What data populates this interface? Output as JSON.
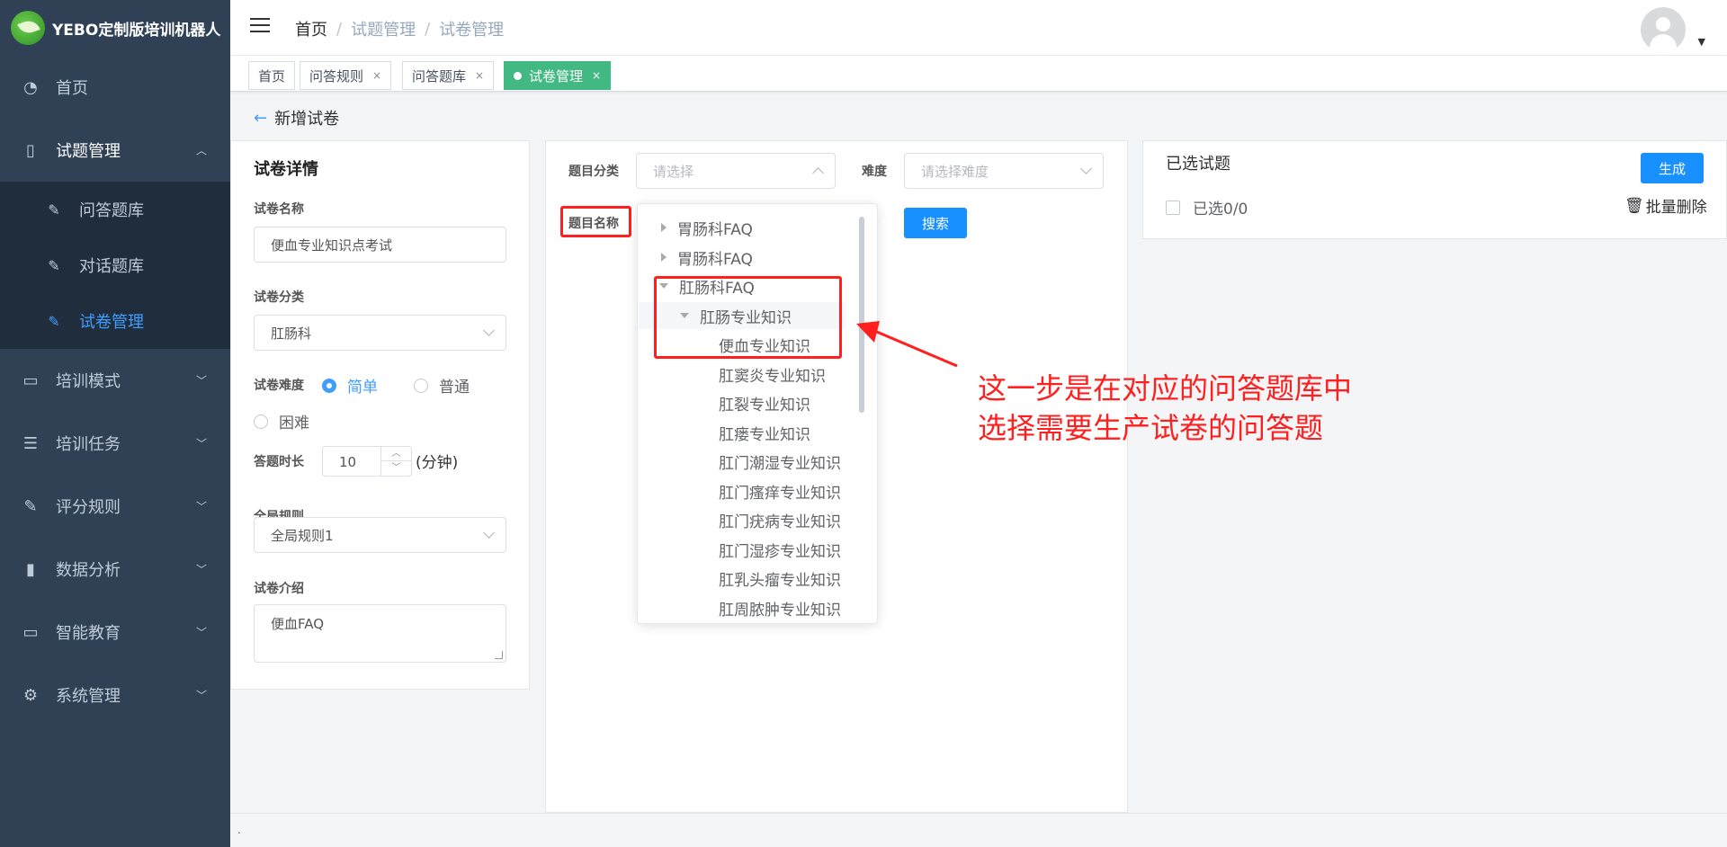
{
  "app": {
    "title": "YEBO定制版培训机器人"
  },
  "sidebar": {
    "items": [
      {
        "label": "首页",
        "icon": "dashboard-icon"
      },
      {
        "label": "试题管理",
        "icon": "book-icon"
      },
      {
        "label": "培训模式",
        "icon": "monitor-icon"
      },
      {
        "label": "培训任务",
        "icon": "list-icon"
      },
      {
        "label": "评分规则",
        "icon": "edit-icon"
      },
      {
        "label": "数据分析",
        "icon": "bar-chart-icon"
      },
      {
        "label": "智能教育",
        "icon": "screen-chart-icon"
      },
      {
        "label": "系统管理",
        "icon": "gear-icon"
      }
    ],
    "submenu": [
      {
        "label": "问答题库"
      },
      {
        "label": "对话题库"
      },
      {
        "label": "试卷管理"
      }
    ]
  },
  "breadcrumb": {
    "home": "首页",
    "level1": "试题管理",
    "level2": "试卷管理"
  },
  "tags": [
    {
      "label": "首页"
    },
    {
      "label": "问答规则"
    },
    {
      "label": "问答题库"
    },
    {
      "label": "试卷管理"
    }
  ],
  "page": {
    "back_label": "新增试卷"
  },
  "left": {
    "title": "试卷详情",
    "name_label": "试卷名称",
    "name_value": "便血专业知识点考试",
    "category_label": "试卷分类",
    "category_value": "肛肠科",
    "difficulty_label": "试卷难度",
    "difficulty_options": [
      "简单",
      "普通",
      "困难"
    ],
    "difficulty_selected": "简单",
    "duration_label": "答题时长",
    "duration_value": "10",
    "duration_unit": "(分钟)",
    "rule_label": "全局规则",
    "rule_value": "全局规则1",
    "intro_label": "试卷介绍",
    "intro_value": "便血FAQ"
  },
  "middle": {
    "category_label": "题目分类",
    "category_placeholder": "请选择",
    "difficulty_label": "难度",
    "difficulty_placeholder": "请选择难度",
    "name_label": "题目名称",
    "search_label": "搜索"
  },
  "tree": [
    {
      "label": "胃肠科FAQ",
      "level": 0,
      "expanded": false
    },
    {
      "label": "胃肠科FAQ",
      "level": 0,
      "expanded": false
    },
    {
      "label": "肛肠科FAQ",
      "level": 0,
      "expanded": true
    },
    {
      "label": "肛肠专业知识",
      "level": 1,
      "expanded": true
    },
    {
      "label": "便血专业知识",
      "level": 2
    },
    {
      "label": "肛窦炎专业知识",
      "level": 2
    },
    {
      "label": "肛裂专业知识",
      "level": 2
    },
    {
      "label": "肛瘘专业知识",
      "level": 2
    },
    {
      "label": "肛门潮湿专业知识",
      "level": 2
    },
    {
      "label": "肛门瘙痒专业知识",
      "level": 2
    },
    {
      "label": "肛门疣病专业知识",
      "level": 2
    },
    {
      "label": "肛门湿疹专业知识",
      "level": 2
    },
    {
      "label": "肛乳头瘤专业知识",
      "level": 2
    },
    {
      "label": "肛周脓肿专业知识",
      "level": 2
    }
  ],
  "right": {
    "title": "已选试题",
    "generate_label": "生成",
    "selected_count": "已选0/0",
    "batch_delete_label": "批量删除"
  },
  "annotation": {
    "line1": "这一步是在对应的问答题库中",
    "line2": "选择需要生产试卷的问答题",
    "color": "#ff1f1f"
  },
  "footer": {
    "text": "."
  },
  "colors": {
    "sidebar_bg": "#304156",
    "active": "#409eff",
    "tag_active": "#42b983",
    "primary_button": "#1890ff"
  }
}
